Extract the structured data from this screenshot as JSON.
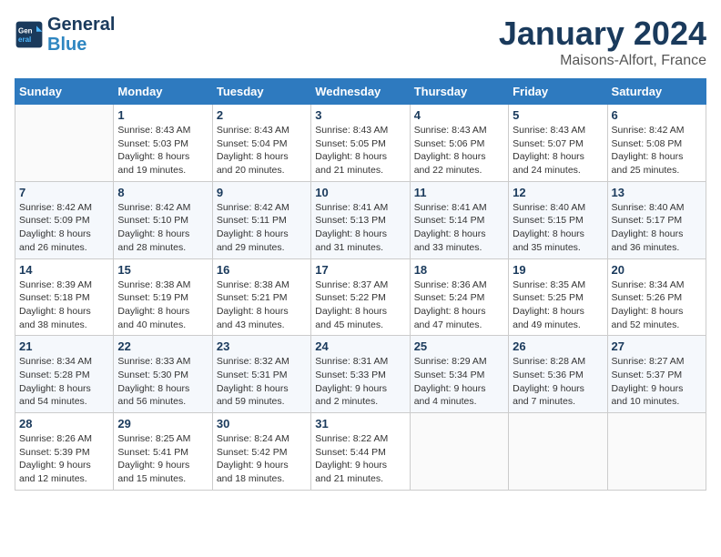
{
  "header": {
    "logo_line1": "General",
    "logo_line2": "Blue",
    "month": "January 2024",
    "location": "Maisons-Alfort, France"
  },
  "weekdays": [
    "Sunday",
    "Monday",
    "Tuesday",
    "Wednesday",
    "Thursday",
    "Friday",
    "Saturday"
  ],
  "weeks": [
    [
      {
        "day": "",
        "info": ""
      },
      {
        "day": "1",
        "info": "Sunrise: 8:43 AM\nSunset: 5:03 PM\nDaylight: 8 hours\nand 19 minutes."
      },
      {
        "day": "2",
        "info": "Sunrise: 8:43 AM\nSunset: 5:04 PM\nDaylight: 8 hours\nand 20 minutes."
      },
      {
        "day": "3",
        "info": "Sunrise: 8:43 AM\nSunset: 5:05 PM\nDaylight: 8 hours\nand 21 minutes."
      },
      {
        "day": "4",
        "info": "Sunrise: 8:43 AM\nSunset: 5:06 PM\nDaylight: 8 hours\nand 22 minutes."
      },
      {
        "day": "5",
        "info": "Sunrise: 8:43 AM\nSunset: 5:07 PM\nDaylight: 8 hours\nand 24 minutes."
      },
      {
        "day": "6",
        "info": "Sunrise: 8:42 AM\nSunset: 5:08 PM\nDaylight: 8 hours\nand 25 minutes."
      }
    ],
    [
      {
        "day": "7",
        "info": "Sunrise: 8:42 AM\nSunset: 5:09 PM\nDaylight: 8 hours\nand 26 minutes."
      },
      {
        "day": "8",
        "info": "Sunrise: 8:42 AM\nSunset: 5:10 PM\nDaylight: 8 hours\nand 28 minutes."
      },
      {
        "day": "9",
        "info": "Sunrise: 8:42 AM\nSunset: 5:11 PM\nDaylight: 8 hours\nand 29 minutes."
      },
      {
        "day": "10",
        "info": "Sunrise: 8:41 AM\nSunset: 5:13 PM\nDaylight: 8 hours\nand 31 minutes."
      },
      {
        "day": "11",
        "info": "Sunrise: 8:41 AM\nSunset: 5:14 PM\nDaylight: 8 hours\nand 33 minutes."
      },
      {
        "day": "12",
        "info": "Sunrise: 8:40 AM\nSunset: 5:15 PM\nDaylight: 8 hours\nand 35 minutes."
      },
      {
        "day": "13",
        "info": "Sunrise: 8:40 AM\nSunset: 5:17 PM\nDaylight: 8 hours\nand 36 minutes."
      }
    ],
    [
      {
        "day": "14",
        "info": "Sunrise: 8:39 AM\nSunset: 5:18 PM\nDaylight: 8 hours\nand 38 minutes."
      },
      {
        "day": "15",
        "info": "Sunrise: 8:38 AM\nSunset: 5:19 PM\nDaylight: 8 hours\nand 40 minutes."
      },
      {
        "day": "16",
        "info": "Sunrise: 8:38 AM\nSunset: 5:21 PM\nDaylight: 8 hours\nand 43 minutes."
      },
      {
        "day": "17",
        "info": "Sunrise: 8:37 AM\nSunset: 5:22 PM\nDaylight: 8 hours\nand 45 minutes."
      },
      {
        "day": "18",
        "info": "Sunrise: 8:36 AM\nSunset: 5:24 PM\nDaylight: 8 hours\nand 47 minutes."
      },
      {
        "day": "19",
        "info": "Sunrise: 8:35 AM\nSunset: 5:25 PM\nDaylight: 8 hours\nand 49 minutes."
      },
      {
        "day": "20",
        "info": "Sunrise: 8:34 AM\nSunset: 5:26 PM\nDaylight: 8 hours\nand 52 minutes."
      }
    ],
    [
      {
        "day": "21",
        "info": "Sunrise: 8:34 AM\nSunset: 5:28 PM\nDaylight: 8 hours\nand 54 minutes."
      },
      {
        "day": "22",
        "info": "Sunrise: 8:33 AM\nSunset: 5:30 PM\nDaylight: 8 hours\nand 56 minutes."
      },
      {
        "day": "23",
        "info": "Sunrise: 8:32 AM\nSunset: 5:31 PM\nDaylight: 8 hours\nand 59 minutes."
      },
      {
        "day": "24",
        "info": "Sunrise: 8:31 AM\nSunset: 5:33 PM\nDaylight: 9 hours\nand 2 minutes."
      },
      {
        "day": "25",
        "info": "Sunrise: 8:29 AM\nSunset: 5:34 PM\nDaylight: 9 hours\nand 4 minutes."
      },
      {
        "day": "26",
        "info": "Sunrise: 8:28 AM\nSunset: 5:36 PM\nDaylight: 9 hours\nand 7 minutes."
      },
      {
        "day": "27",
        "info": "Sunrise: 8:27 AM\nSunset: 5:37 PM\nDaylight: 9 hours\nand 10 minutes."
      }
    ],
    [
      {
        "day": "28",
        "info": "Sunrise: 8:26 AM\nSunset: 5:39 PM\nDaylight: 9 hours\nand 12 minutes."
      },
      {
        "day": "29",
        "info": "Sunrise: 8:25 AM\nSunset: 5:41 PM\nDaylight: 9 hours\nand 15 minutes."
      },
      {
        "day": "30",
        "info": "Sunrise: 8:24 AM\nSunset: 5:42 PM\nDaylight: 9 hours\nand 18 minutes."
      },
      {
        "day": "31",
        "info": "Sunrise: 8:22 AM\nSunset: 5:44 PM\nDaylight: 9 hours\nand 21 minutes."
      },
      {
        "day": "",
        "info": ""
      },
      {
        "day": "",
        "info": ""
      },
      {
        "day": "",
        "info": ""
      }
    ]
  ]
}
